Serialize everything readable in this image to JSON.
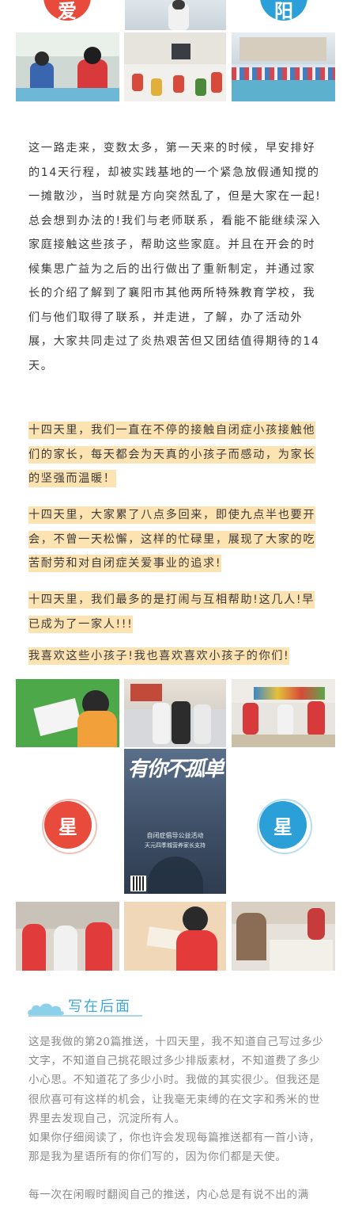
{
  "badges": {
    "top_left": {
      "char": "爱",
      "color": "#e84a3c"
    },
    "top_right": {
      "char": "阳",
      "color": "#2b9fd8"
    },
    "mid_left": {
      "char": "星",
      "color": "#e84a3c"
    },
    "mid_right": {
      "char": "星",
      "color": "#2b9fd8"
    }
  },
  "story": {
    "paragraph": "这一路走来，变数太多，第一天来的时候，早安排好的14天行程，却被实践基地的一个紧急放假通知搅的一摊散沙，当时就是方向突然乱了，但是大家在一起!总会想到办法的!我们与老师联系，看能不能继续深入家庭接触这些孩子，帮助这些家庭。并且在开会的时候集思广益为之后的出行做出了重新制定，并通过家长的介绍了解到了襄阳市其他两所特殊教育学校，我们与他们取得了联系，并走进，了解，办了活动外展，大家共同走过了炎热艰苦但又团结值得期待的14天。",
    "highlight_1": "十四天里，我们一直在不停的接触自闭症小孩接触他们的家长，每天都会为天真的小孩子而感动，为家长的坚强而温暖！",
    "highlight_2": "十四天里，大家累了八点多回来，即使九点半也要开会，不曾一天松懈，这样的忙碌里，展现了大家的吃苦耐劳和对自闭症关爱事业的追求!",
    "highlight_3": "十四天里，我们最多的是打闹与互相帮助!这几人!早已成为了一家人!!!",
    "highlight_4": "我喜欢这些小孩子!我也喜欢喜欢小孩子的你们!"
  },
  "poster": {
    "headline": "有你不孤单",
    "sub_1": "自闭症倡导公益活动",
    "sub_2": "天元四季城营养家长支持"
  },
  "after": {
    "title": "写在后面",
    "p1": "这是我做的第20篇推送，十四天里，我不知道自己写过多少文字，不知道自己挑花眼过多少排版素材，不知道费了多少小心思。不知道花了多少小时。我做的其实很少。但我还是很欣喜可有这样的机会，让我毫无束缚的在文字和秀米的世界里去发现自己，沉淀所有人。",
    "p2": "如果你仔细阅读了，你也许会发现每篇推送都有一首小诗，那是我为星语所有的你们写的，因为你们都是天使。",
    "p3": "每一次在闲暇时翻阅自己的推送，内心总是有说不出的满"
  },
  "colors": {
    "accent_red": "#e84a3c",
    "accent_blue": "#2b9fd8",
    "highlight": "#fde2b2",
    "title_blue": "#3fa8d8"
  }
}
